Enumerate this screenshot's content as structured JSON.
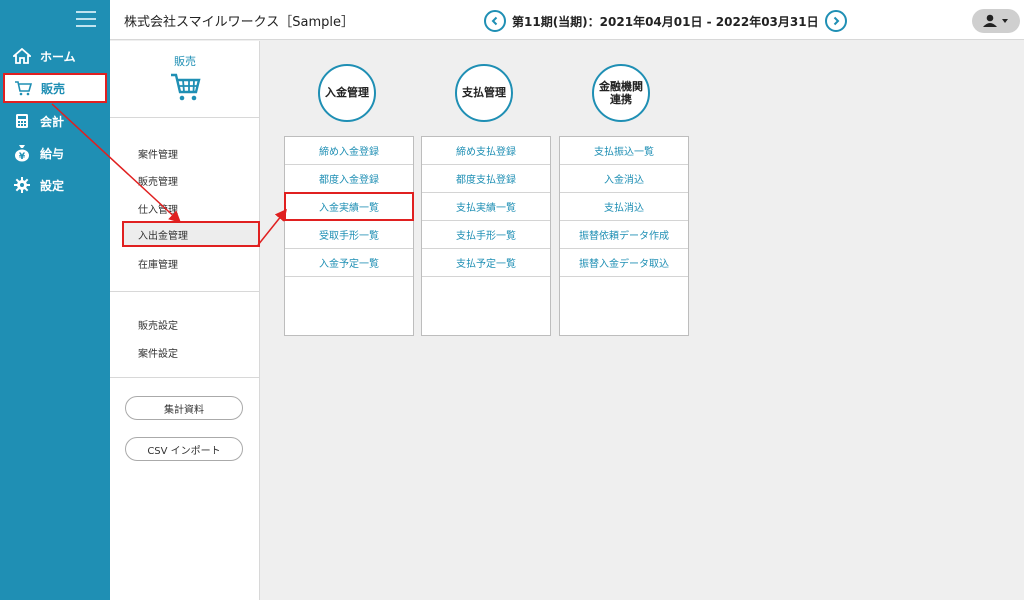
{
  "header": {
    "company": "株式会社スマイルワークス［Sample］",
    "period": "第11期(当期)：2021年04月01日 - 2022年03月31日"
  },
  "nav": {
    "items": [
      {
        "label": "ホーム",
        "icon": "home-icon"
      },
      {
        "label": "販売",
        "icon": "cart-icon"
      },
      {
        "label": "会計",
        "icon": "calculator-icon"
      },
      {
        "label": "給与",
        "icon": "yen-bag-icon"
      },
      {
        "label": "設定",
        "icon": "gear-icon"
      }
    ]
  },
  "sidebar": {
    "title": "販売",
    "group1": [
      "案件管理",
      "販売管理",
      "仕入管理",
      "入出金管理",
      "在庫管理"
    ],
    "group2": [
      "販売設定",
      "案件設定"
    ],
    "buttons": [
      "集計資料",
      "CSV インポート"
    ]
  },
  "categories": [
    {
      "title": "入金管理",
      "links": [
        "締め入金登録",
        "都度入金登録",
        "入金実績一覧",
        "受取手形一覧",
        "入金予定一覧"
      ]
    },
    {
      "title": "支払管理",
      "links": [
        "締め支払登録",
        "都度支払登録",
        "支払実績一覧",
        "支払手形一覧",
        "支払予定一覧"
      ]
    },
    {
      "title_line1": "金融機関",
      "title_line2": "連携",
      "links": [
        "支払振込一覧",
        "入金消込",
        "支払消込",
        "振替依頼データ作成",
        "振替入金データ取込"
      ]
    }
  ],
  "colors": {
    "accent": "#1f8fb4",
    "highlight": "#e02020"
  }
}
